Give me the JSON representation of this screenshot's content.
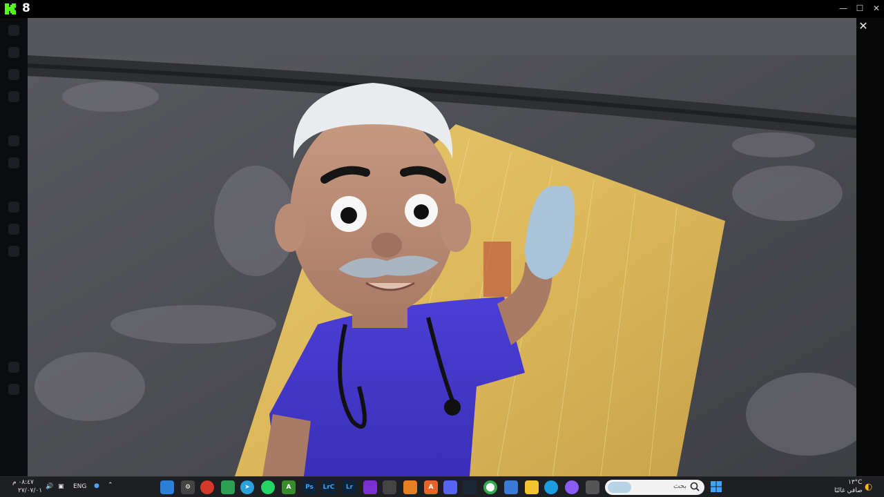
{
  "app": {
    "count": "8"
  },
  "window_controls": {
    "minimize": "—",
    "maximize": "☐",
    "close": "✕"
  },
  "viewer": {
    "close_label": "✕"
  },
  "taskbar": {
    "tray": {
      "time": "٠٨:٤٧ م",
      "date": "٢٧/٠٧/٠١",
      "lang": "ENG"
    },
    "search": {
      "placeholder": "بحث"
    },
    "weather": {
      "temp": "١٣°C",
      "condition": "صافي غالبًا"
    },
    "apps": [
      {
        "name": "store",
        "label": ""
      },
      {
        "name": "settings",
        "label": ""
      },
      {
        "name": "browser",
        "label": ""
      },
      {
        "name": "app",
        "label": ""
      },
      {
        "name": "telegram",
        "label": ""
      },
      {
        "name": "whatsapp",
        "label": ""
      },
      {
        "name": "android",
        "label": ""
      },
      {
        "name": "photoshop",
        "label": "Ps"
      },
      {
        "name": "lrc",
        "label": "LrC"
      },
      {
        "name": "lightroom",
        "label": "Lr"
      },
      {
        "name": "app",
        "label": ""
      },
      {
        "name": "app",
        "label": ""
      },
      {
        "name": "app",
        "label": ""
      },
      {
        "name": "app",
        "label": ""
      },
      {
        "name": "discord",
        "label": ""
      },
      {
        "name": "steam",
        "label": ""
      },
      {
        "name": "chrome",
        "label": ""
      },
      {
        "name": "calendar",
        "label": ""
      },
      {
        "name": "explorer",
        "label": ""
      },
      {
        "name": "edge",
        "label": ""
      },
      {
        "name": "copilot",
        "label": ""
      },
      {
        "name": "app",
        "label": ""
      }
    ]
  },
  "colors": {
    "accent": "#53fc18",
    "taskbar": "#1e1f22"
  }
}
